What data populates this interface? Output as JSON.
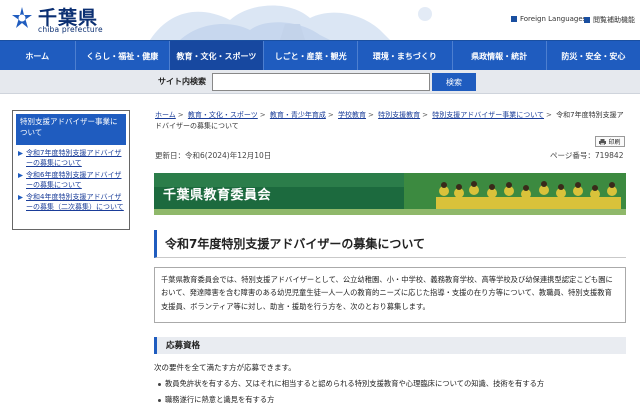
{
  "header": {
    "logo_name": "千葉県",
    "logo_sub": "chiba prefecture",
    "util_links": [
      "Foreign Languages",
      "閲覧補助機能"
    ]
  },
  "nav": {
    "items": [
      "ホーム",
      "くらし・福祉・健康",
      "教育・文化・スポーツ",
      "しごと・産業・観光",
      "環境・まちづくり",
      "県政情報・統計",
      "防災・安全・安心"
    ],
    "active_index": 2
  },
  "search": {
    "label": "サイト内検索",
    "placeholder": "",
    "button": "検索"
  },
  "sidebar": {
    "title": "特別支援アドバイザー事業について",
    "items": [
      "令和7年度特別支援アドバイザーの募集について",
      "令和6年度特別支援アドバイザーの募集について",
      "令和4年度特別支援アドバイザーの募集（二次募集）について"
    ]
  },
  "breadcrumb": {
    "links": [
      "ホーム",
      "教育・文化・スポーツ",
      "教育・青少年育成",
      "学校教育",
      "特別支援教育",
      "特別支援アドバイザー事業について"
    ],
    "current": "令和7年度特別支援アドバイザーの募集について"
  },
  "toolbar": {
    "print_label": "印刷"
  },
  "meta": {
    "updated": "更新日：令和6(2024)年12月10日",
    "page_id": "ページ番号：719842"
  },
  "banner": {
    "title": "千葉県教育委員会"
  },
  "page": {
    "title": "令和7年度特別支援アドバイザーの募集について",
    "intro": "千葉県教育委員会では、特別支援アドバイザーとして、公立幼稚園、小・中学校、義務教育学校、高等学校及び幼保連携型認定こども園において、発達障害を含む障害のある幼児児童生徒一人一人の教育的ニーズに応じた指導・支援の在り方等について、教職員、特別支援教育支援員、ボランティア等に対し、助言・援助を行う方を、次のとおり募集します。",
    "section1": {
      "heading": "応募資格",
      "lead": "次の要件を全て満たす方が応募できます。",
      "bullets": [
        "教員免許状を有する方、又はそれに相当すると認められる特別支援教育や心理臨床についての知識、技術を有する方",
        "職務遂行に熱意と識見を有する方"
      ]
    }
  },
  "colors": {
    "nav_blue": "#1f5cbf",
    "logo_navy": "#0b2f72",
    "banner_green": "#1c6a3e"
  }
}
